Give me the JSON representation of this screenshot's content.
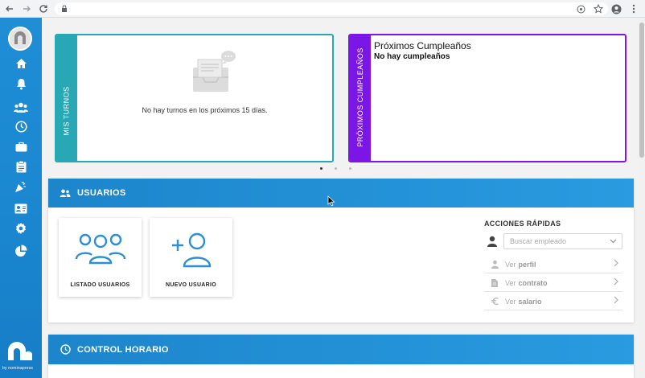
{
  "browser": {
    "back_icon": "arrow-left-icon",
    "forward_icon": "arrow-right-icon",
    "reload_icon": "reload-icon",
    "lock_icon": "lock-icon",
    "addon_icon": "circle-plus-icon",
    "star_icon": "star-icon",
    "account_icon": "account-icon",
    "menu_icon": "more-vert-icon"
  },
  "sidebar": {
    "items": [
      {
        "name": "home"
      },
      {
        "name": "bell"
      },
      {
        "name": "users"
      },
      {
        "name": "clock"
      },
      {
        "name": "briefcase"
      },
      {
        "name": "clipboard"
      },
      {
        "name": "party"
      },
      {
        "name": "id-card"
      },
      {
        "name": "gear"
      },
      {
        "name": "pie-chart"
      }
    ],
    "by_label": "by nominapress"
  },
  "mis_turnos": {
    "stripe_label": "MIS TURNOS",
    "empty_text": "No hay turnos en los próximos 15 días."
  },
  "cumpleanos": {
    "stripe_label": "PRÓXIMOS CUMPLEAÑOS",
    "title": "Próximos Cumpleaños",
    "subtitle": "No hay cumpleaños"
  },
  "carousel": {
    "total": 3,
    "active": 0
  },
  "usuarios": {
    "header": "USUARIOS",
    "tiles": [
      {
        "label": "LISTADO USUARIOS"
      },
      {
        "label": "NUEVO USUARIO"
      }
    ],
    "quick": {
      "title": "ACCIONES RÁPIDAS",
      "search_placeholder": "Buscar empleado",
      "actions": [
        {
          "prefix": "Ver",
          "bold": "perfil"
        },
        {
          "prefix": "Ver",
          "bold": "contrato"
        },
        {
          "prefix": "Ver",
          "bold": "salario"
        }
      ]
    }
  },
  "control_horario": {
    "header": "CONTROL HORARIO"
  },
  "colors": {
    "sidebar": "#1a86d0",
    "turnos": "#27a8b4",
    "cumple": "#7b17e6",
    "header_blue": "#1c85cc",
    "icon_blue": "#2b8fd6"
  }
}
